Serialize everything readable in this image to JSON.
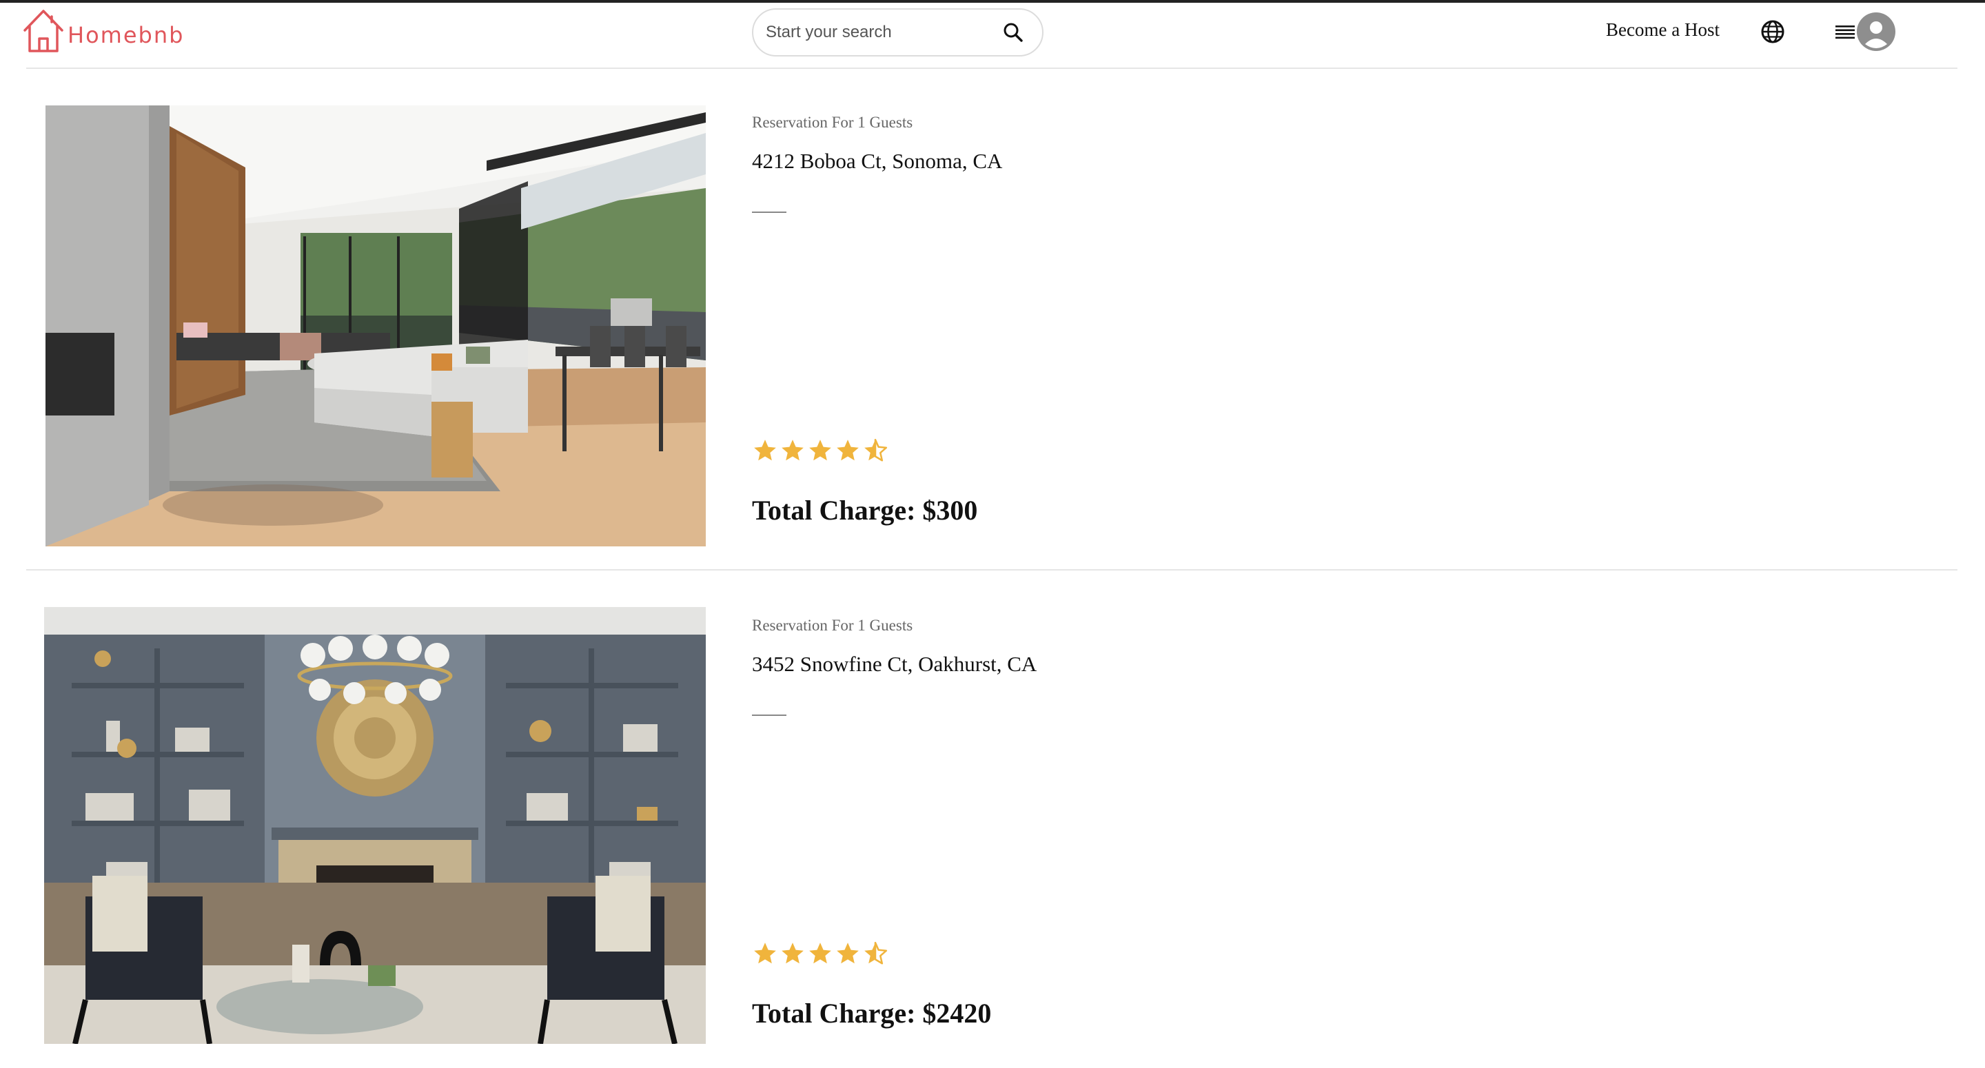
{
  "header": {
    "logo_text": "Homebnb",
    "brand_color": "#e0565b",
    "search": {
      "placeholder": "Start your search",
      "value": ""
    },
    "become_host_label": "Become a Host",
    "icons": [
      "home-logo-icon",
      "search-icon",
      "globe-icon",
      "hamburger-menu-icon",
      "user-avatar-icon"
    ]
  },
  "reservations": [
    {
      "guests_label": "Reservation For 1 Guests",
      "address": "4212 Boboa Ct, Sonoma, CA",
      "rating": 4.5,
      "total_charge": "Total Charge: $300",
      "photo": "modern living room with open glass wall onto patio"
    },
    {
      "guests_label": "Reservation For 1 Guests",
      "address": "3452 Snowfine Ct, Oakhurst, CA",
      "rating": 4.5,
      "total_charge": "Total Charge: $2420",
      "photo": "gray living room with bookshelves, fireplace and chandelier"
    }
  ],
  "star_color": "#f0b43c"
}
